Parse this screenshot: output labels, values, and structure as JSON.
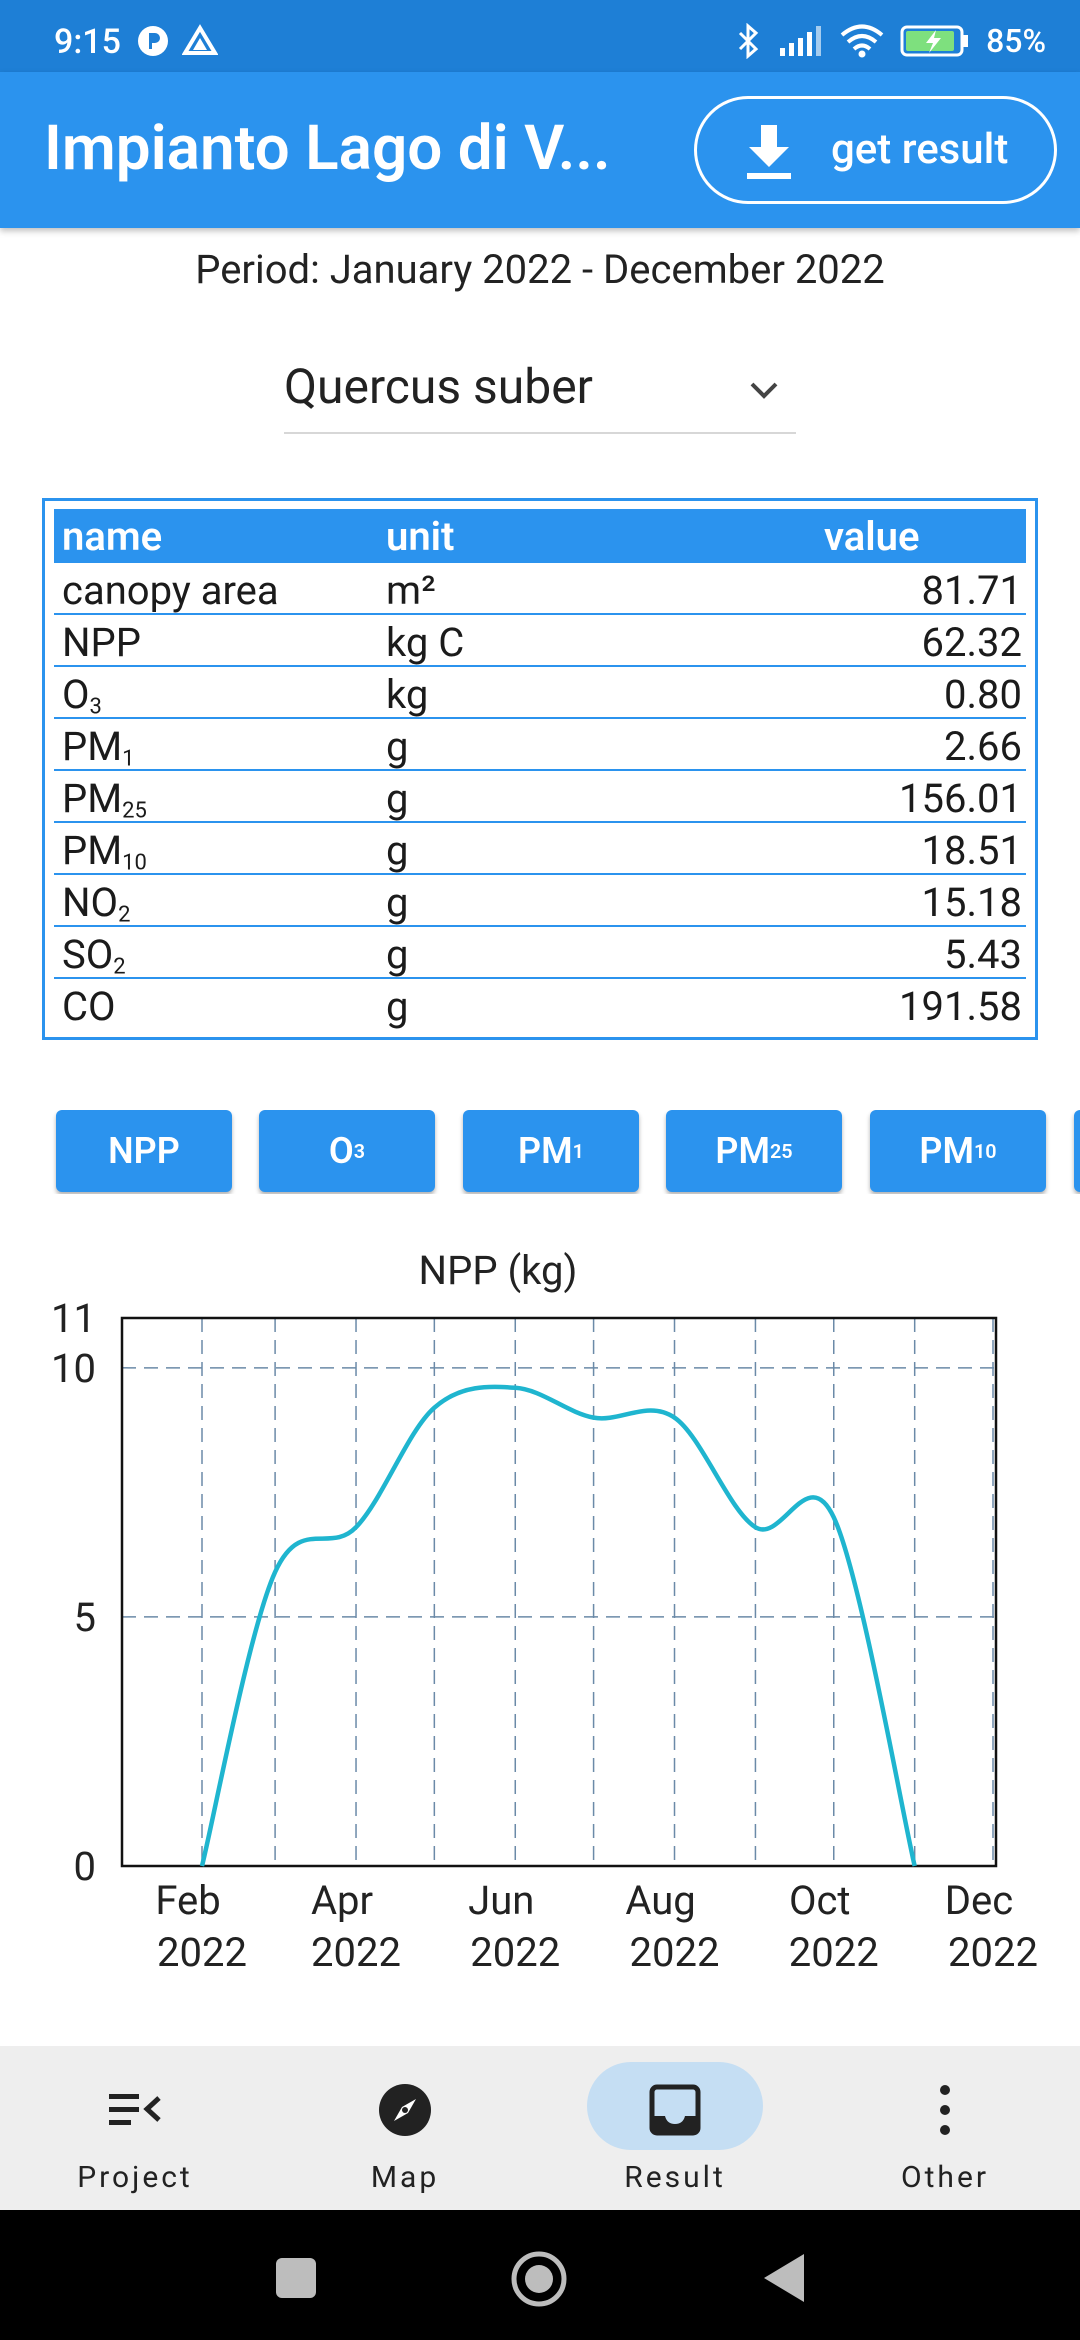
{
  "status_bar": {
    "time": "9:15",
    "battery": "85%"
  },
  "app_bar": {
    "title": "Impianto Lago di V...",
    "get_result_label": "get result"
  },
  "period": "Period: January 2022 - December 2022",
  "species_dropdown": {
    "selected": "Quercus suber"
  },
  "table": {
    "headers": {
      "name": "name",
      "unit": "unit",
      "value": "value"
    },
    "rows": [
      {
        "name": "canopy area",
        "unit": "m²",
        "value": "81.71"
      },
      {
        "name": "NPP",
        "unit": "kg C",
        "value": "62.32"
      },
      {
        "name": "O",
        "sub": "3",
        "unit": "kg",
        "value": "0.80"
      },
      {
        "name": "PM",
        "sub": "1",
        "unit": "g",
        "value": "2.66"
      },
      {
        "name": "PM",
        "sub": "25",
        "unit": "g",
        "value": "156.01"
      },
      {
        "name": "PM",
        "sub": "10",
        "unit": "g",
        "value": "18.51"
      },
      {
        "name": "NO",
        "sub": "2",
        "unit": "g",
        "value": "15.18"
      },
      {
        "name": "SO",
        "sub": "2",
        "unit": "g",
        "value": "5.43"
      },
      {
        "name": "CO",
        "unit": "g",
        "value": "191.58"
      }
    ]
  },
  "pollutant_buttons": [
    {
      "label": "NPP"
    },
    {
      "label": "O",
      "sub": "3"
    },
    {
      "label": "PM",
      "sub": "1"
    },
    {
      "label": "PM",
      "sub": "25"
    },
    {
      "label": "PM",
      "sub": "10"
    }
  ],
  "chart_data": {
    "type": "line",
    "title": "NPP (kg)",
    "ylim": [
      0,
      11
    ],
    "yticks": [
      0,
      5,
      10,
      11
    ],
    "x_ticks": [
      {
        "l1": "Feb",
        "l2": "2022"
      },
      {
        "l1": "Apr",
        "l2": "2022"
      },
      {
        "l1": "Jun",
        "l2": "2022"
      },
      {
        "l1": "Aug",
        "l2": "2022"
      },
      {
        "l1": "Oct",
        "l2": "2022"
      },
      {
        "l1": "Dec",
        "l2": "2022"
      }
    ],
    "series": [
      {
        "color": "#1fb5cf",
        "x": [
          "2022-02-01",
          "2022-03-01",
          "2022-04-01",
          "2022-05-01",
          "2022-06-01",
          "2022-07-01",
          "2022-08-01",
          "2022-09-01",
          "2022-10-01",
          "2022-11-01"
        ],
        "values": [
          0,
          5.9,
          6.8,
          9.2,
          9.6,
          9.0,
          9.0,
          6.8,
          7.0,
          0
        ]
      }
    ],
    "grid": true,
    "line_color": "#1fb5cf"
  },
  "bottom_nav": [
    {
      "label": "Project",
      "icon": "project-list-icon"
    },
    {
      "label": "Map",
      "icon": "compass-icon"
    },
    {
      "label": "Result",
      "icon": "inbox-icon",
      "active": true
    },
    {
      "label": "Other",
      "icon": "more-vert-icon"
    }
  ]
}
